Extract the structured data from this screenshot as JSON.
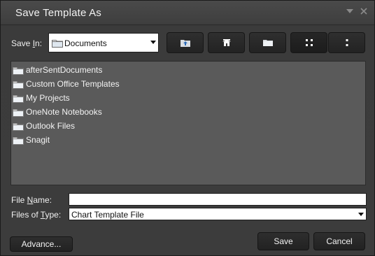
{
  "window": {
    "title": "Save Template As",
    "dropdown_icon": "triangle-down-icon",
    "close_icon": "close-icon"
  },
  "save_in": {
    "label_pre": "Save ",
    "label_mnemonic": "I",
    "label_post": "n:",
    "value": "Documents",
    "icon": "folder-icon"
  },
  "toolbar": {
    "buttons": [
      {
        "name": "up-folder-button",
        "icon": "folder-up-icon"
      },
      {
        "name": "home-button",
        "icon": "home-icon"
      },
      {
        "name": "new-folder-button",
        "icon": "new-folder-icon"
      },
      {
        "name": "list-view-button",
        "icon": "list-view-icon",
        "active": true
      },
      {
        "name": "details-view-button",
        "icon": "details-view-icon"
      }
    ]
  },
  "files": [
    {
      "name": "afterSentDocuments",
      "icon": "folder-icon"
    },
    {
      "name": "Custom Office Templates",
      "icon": "folder-icon"
    },
    {
      "name": "My Projects",
      "icon": "folder-icon"
    },
    {
      "name": "OneNote Notebooks",
      "icon": "folder-icon"
    },
    {
      "name": "Outlook Files",
      "icon": "folder-icon"
    },
    {
      "name": "Snagit",
      "icon": "folder-icon"
    }
  ],
  "file_name": {
    "label_pre": "File ",
    "label_mnemonic": "N",
    "label_post": "ame:",
    "value": ""
  },
  "files_of_type": {
    "label_pre": "Files of ",
    "label_mnemonic": "T",
    "label_post": "ype:",
    "value": "Chart Template File"
  },
  "buttons": {
    "advance": "Advance...",
    "save": "Save",
    "cancel": "Cancel"
  },
  "colors": {
    "dialog_bg": "#3b3b3b",
    "list_bg": "#5a5a5a",
    "button_bg": "#262626",
    "text": "#f0f0f0"
  }
}
